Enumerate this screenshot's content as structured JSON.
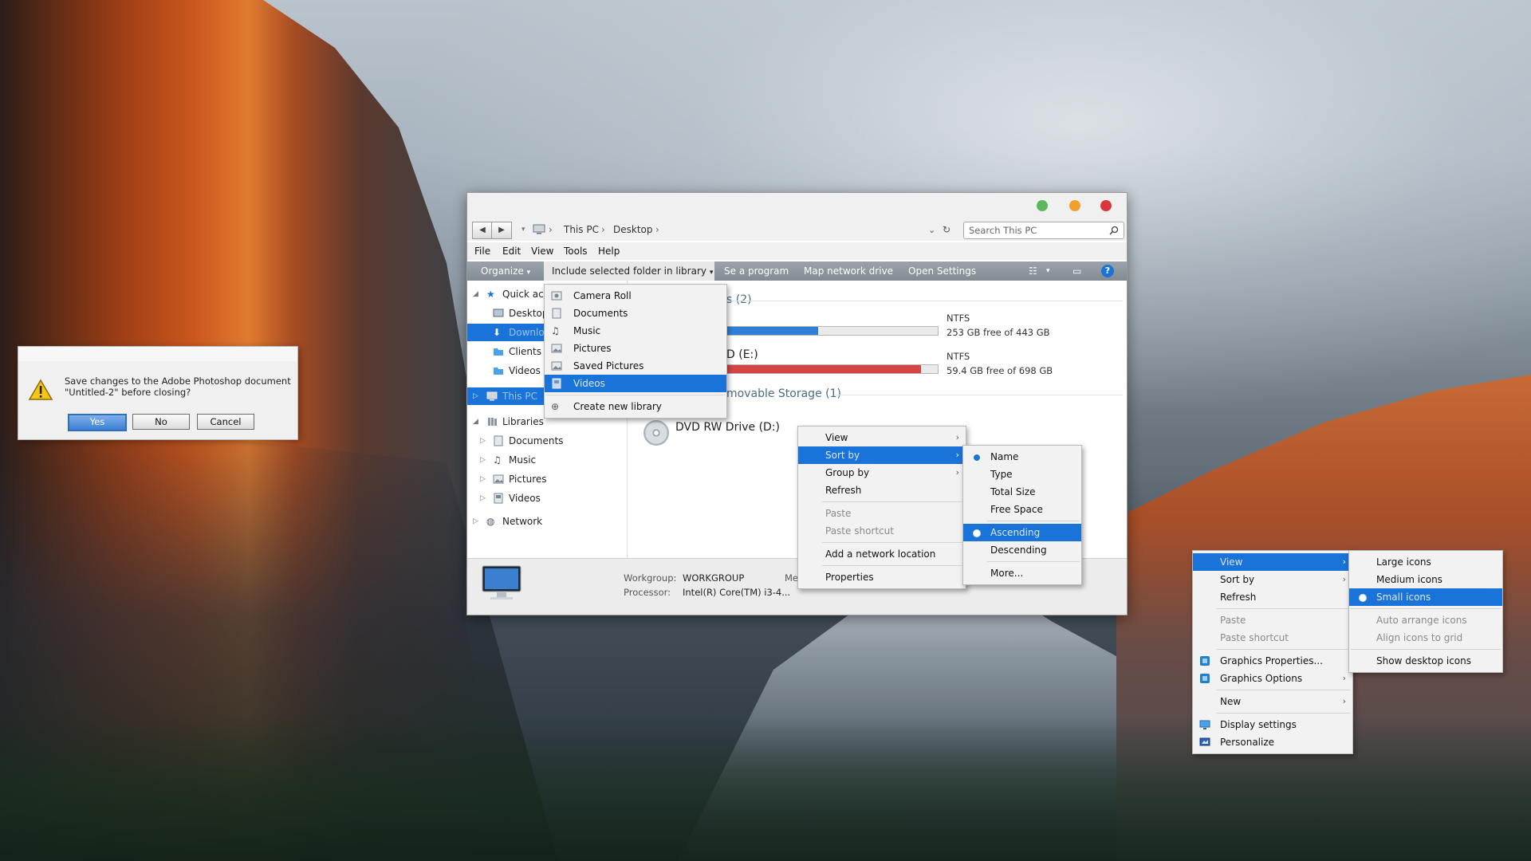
{
  "dialog": {
    "message": "Save changes to the Adobe Photoshop document \"Untitled-2\" before closing?",
    "yes": "Yes",
    "no": "No",
    "cancel": "Cancel"
  },
  "explorer": {
    "breadcrumb": [
      "This PC",
      "Desktop"
    ],
    "search_placeholder": "Search This PC",
    "menubar": [
      "File",
      "Edit",
      "View",
      "Tools",
      "Help"
    ],
    "toolbar": {
      "organize": "Organize",
      "include": "Include selected folder in library",
      "uninstall": "Se a program",
      "map_drive": "Map network drive",
      "open_settings": "Open Settings"
    },
    "library_menu": {
      "items": [
        "Camera Roll",
        "Documents",
        "Music",
        "Pictures",
        "Saved Pictures",
        "Videos"
      ],
      "selected": "Videos",
      "create": "Create new library"
    },
    "nav": {
      "quick_access": "Quick acc",
      "desktop": "Desktop",
      "downloads": "Downlo",
      "clients": "Clients",
      "videos": "Videos",
      "this_pc": "This PC",
      "libraries": "Libraries",
      "lib_documents": "Documents",
      "lib_music": "Music",
      "lib_pictures": "Pictures",
      "lib_videos": "Videos",
      "network": "Network"
    },
    "content": {
      "group_devices": "s (2)",
      "drive_c_fs": "NTFS",
      "drive_c_free": "253 GB free of 443 GB",
      "drive_c_usage": 0.43,
      "drive_e_name": "D (E:)",
      "drive_e_fs": "NTFS",
      "drive_e_free": "59.4 GB free of 698 GB",
      "drive_e_usage": 0.92,
      "group_removable": "movable Storage (1)",
      "dvd": "DVD RW Drive (D:)"
    },
    "status": {
      "workgroup_label": "Workgroup:",
      "workgroup": "WORKGROUP",
      "processor_label": "Processor:",
      "processor": "Intel(R) Core(TM) i3-4...",
      "me_label": "Me"
    },
    "context_menu": {
      "view": "View",
      "sort_by": "Sort by",
      "group_by": "Group by",
      "refresh": "Refresh",
      "paste": "Paste",
      "paste_shortcut": "Paste shortcut",
      "add_network": "Add a network location",
      "properties": "Properties"
    },
    "sort_menu": {
      "name": "Name",
      "type": "Type",
      "total_size": "Total Size",
      "free_space": "Free Space",
      "ascending": "Ascending",
      "descending": "Descending",
      "more": "More..."
    }
  },
  "desktop_menu": {
    "view": "View",
    "sort_by": "Sort by",
    "refresh": "Refresh",
    "paste": "Paste",
    "paste_shortcut": "Paste shortcut",
    "graphics_properties": "Graphics Properties...",
    "graphics_options": "Graphics Options",
    "new": "New",
    "display_settings": "Display settings",
    "personalize": "Personalize"
  },
  "view_menu": {
    "large": "Large icons",
    "medium": "Medium icons",
    "small": "Small icons",
    "auto_arrange": "Auto arrange icons",
    "align": "Align icons to grid",
    "show_desktop": "Show desktop icons"
  },
  "colors": {
    "selection": "#1a73d8",
    "traffic_green": "#5cb85c",
    "traffic_yellow": "#f0a030",
    "traffic_red": "#d9363e",
    "drive_c_fill": "#2f7fd6",
    "drive_e_fill": "#d64545"
  }
}
